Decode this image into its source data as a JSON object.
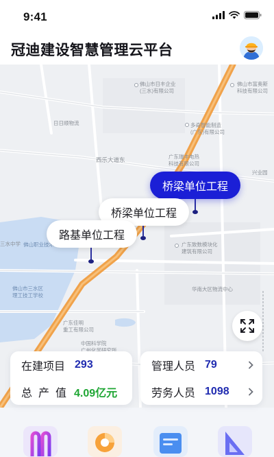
{
  "status_bar": {
    "time": "9:41"
  },
  "header": {
    "title": "冠迪建设智慧管理云平台"
  },
  "map": {
    "labels": {
      "l1": "佛山市日丰企业\n(三水)有限公司",
      "l2": "佛山市富奥斯\n科技有限公司",
      "l3": "日日顺物流",
      "l4": "多奇智能制造\n(广东)有限公司",
      "l5": "西乐大道东",
      "l6": "广东瑞丰电热\n科技有限公司",
      "l7": "兴业园",
      "l8": "广东致数模块化\n建筑有限公司",
      "l9": "华南大区物流中心",
      "l10": "佛山市三水区\n理工技工学校",
      "l11": "广东佳明\n重工有限公司",
      "l12": "中国科学院\n广州化学研究所",
      "l13": "三水中学",
      "l14": "佛山职业技术"
    },
    "markers": [
      {
        "label": "桥梁单位工程"
      },
      {
        "label": "桥梁单位工程"
      },
      {
        "label": "路基单位工程"
      }
    ]
  },
  "stats": {
    "left": [
      {
        "label": "在建项目",
        "value": "293"
      },
      {
        "label": "总产值",
        "value": "4.09亿元"
      }
    ],
    "right": [
      {
        "label": "管理人员",
        "value": "79"
      },
      {
        "label": "劳务人员",
        "value": "1098"
      }
    ]
  },
  "colors": {
    "accent": "#1b1fd6",
    "value_blue": "#1f2bb0",
    "value_green": "#1fa634",
    "highway": "#f0a24a",
    "water": "#c9dcf3"
  },
  "icons": [
    "signal-icon",
    "wifi-icon",
    "battery-icon",
    "avatar-worker-icon",
    "fullscreen-icon",
    "chevron-right-icon",
    "nav-icon-1",
    "nav-icon-2",
    "nav-icon-3",
    "nav-icon-4"
  ]
}
